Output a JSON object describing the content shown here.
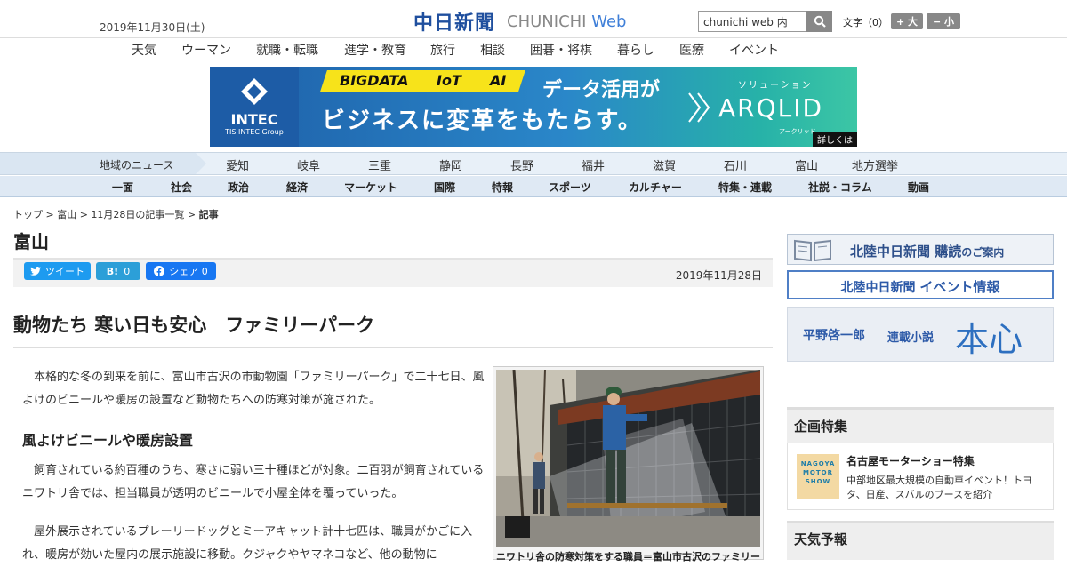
{
  "header": {
    "date": "2019年11月30日(土)",
    "logo_jp": "中日新聞",
    "logo_en": "CHUNICHI",
    "logo_web": "Web",
    "search_value": "chunichi web 内",
    "font_label": "文字（0）",
    "font_larger": "+ 大",
    "font_smaller": "− 小"
  },
  "topnav": [
    "天気",
    "ウーマン",
    "就職・転職",
    "進学・教育",
    "旅行",
    "相談",
    "囲碁・将棋",
    "暮らし",
    "医療",
    "イベント"
  ],
  "ad": {
    "company": "INTEC",
    "company_sub": "TIS INTEC Group",
    "badges": [
      "BIGDATA",
      "IoT",
      "AI"
    ],
    "line1": "データ活用が",
    "line2": "ビジネスに変革をもたらす。",
    "solution_label": "ソリューション",
    "brand": "ARQLID",
    "brand_sub": "アークリッド",
    "more": "詳しくは"
  },
  "regionnav": {
    "label": "地域のニュース",
    "items": [
      "愛知",
      "岐阜",
      "三重",
      "静岡",
      "長野",
      "福井",
      "滋賀",
      "石川",
      "富山",
      "地方選挙"
    ]
  },
  "catnav": [
    "一面",
    "社会",
    "政治",
    "経済",
    "マーケット",
    "国際",
    "特報",
    "スポーツ",
    "カルチャー",
    "特集・連載",
    "社説・コラム",
    "動画"
  ],
  "breadcrumb": {
    "top": "トップ",
    "region": "富山",
    "list": "11月28日の記事一覧",
    "current": "記事",
    "sep": " > "
  },
  "page_title": "富山",
  "share": {
    "tweet": "ツイート",
    "hatena_count": "0",
    "fb_label": "シェア",
    "fb_count": "0"
  },
  "article": {
    "date": "2019年11月28日",
    "headline": "動物たち 寒い日も安心　ファミリーパーク",
    "p1": "本格的な冬の到来を前に、富山市古沢の市動物園「ファミリーパーク」で二十七日、風よけのビニールや暖房の設置など動物たちへの防寒対策が施された。",
    "subhead": "風よけビニールや暖房設置",
    "p2": "飼育されている約百種のうち、寒さに弱い三十種ほどが対象。二百羽が飼育されているニワトリ舎では、担当職員が透明のビニールで小屋全体を覆っていった。",
    "p3": "屋外展示されているプレーリードッグとミーアキャット計十七匹は、職員がかごに入れ、暖房が効いた屋内の展示施設に移動。クジャクやヤマネコなど、他の動物に",
    "photo_caption": "ニワトリ舎の防寒対策をする職員＝富山市古沢のファミリーパークで"
  },
  "sidebar": {
    "banner1_main": "北陸中日新聞",
    "banner1_sub": "購読",
    "banner1_tail": "のご案内",
    "banner2_main": "北陸中日新聞",
    "banner2_sub": "イベント情報",
    "banner3_author": "平野啓一郎",
    "banner3_label": "連載小説",
    "banner3_title": "本心",
    "kikaku_title": "企画特集",
    "kikaku_thumb": "NAGOYA MOTOR SHOW",
    "kikaku_item_title": "名古屋モーターショー特集",
    "kikaku_item_desc": "中部地区最大規模の自動車イベント！トヨタ、日産、スバルのブースを紹介",
    "weather_title": "天気予報"
  },
  "colors": {
    "brand_blue": "#1f4f9e",
    "twitter": "#1d9bf0",
    "hatena": "#2c9fd8",
    "facebook": "#1877f2"
  }
}
